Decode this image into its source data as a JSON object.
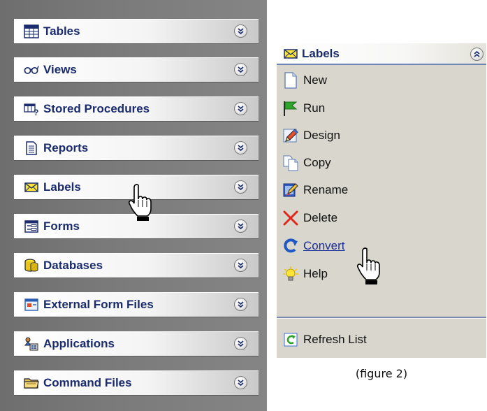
{
  "left_panel": {
    "items": [
      {
        "label": "Tables",
        "icon": "table-grid-icon"
      },
      {
        "label": "Views",
        "icon": "glasses-icon"
      },
      {
        "label": "Stored Procedures",
        "icon": "stored-procedure-icon"
      },
      {
        "label": "Reports",
        "icon": "report-document-icon"
      },
      {
        "label": "Labels",
        "icon": "envelope-icon"
      },
      {
        "label": "Forms",
        "icon": "form-window-icon"
      },
      {
        "label": "Databases",
        "icon": "database-cylinder-icon"
      },
      {
        "label": "External Form Files",
        "icon": "external-form-icon"
      },
      {
        "label": "Applications",
        "icon": "applications-icon"
      },
      {
        "label": "Command Files",
        "icon": "folder-icon"
      }
    ]
  },
  "right_panel": {
    "header_label": "Labels",
    "header_icon": "envelope-icon",
    "items": [
      {
        "label": "New",
        "icon": "new-page-icon"
      },
      {
        "label": "Run",
        "icon": "green-flag-icon"
      },
      {
        "label": "Design",
        "icon": "pencil-icon"
      },
      {
        "label": "Copy",
        "icon": "copy-pages-icon"
      },
      {
        "label": "Rename",
        "icon": "rename-icon"
      },
      {
        "label": "Delete",
        "icon": "red-x-icon"
      },
      {
        "label": "Convert",
        "icon": "convert-arrow-icon"
      },
      {
        "label": "Help",
        "icon": "lightbulb-icon"
      }
    ],
    "refresh_label": "Refresh List",
    "refresh_icon": "refresh-icon"
  },
  "caption": "(figure 2)",
  "colors": {
    "label_text": "#1a2c6e",
    "link": "#1b2f98",
    "menu_bg": "#d8d6cd",
    "left_bg": "#7a7a7a"
  }
}
